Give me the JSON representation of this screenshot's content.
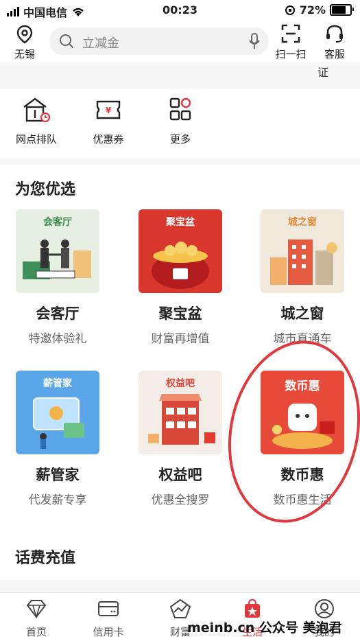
{
  "status": {
    "carrier": "中国电信",
    "time": "00:23",
    "battery": "72%"
  },
  "header": {
    "location": "无锡",
    "search_placeholder": "立减金",
    "scan": "扫一扫",
    "service": "客服"
  },
  "partial_row": {
    "last_label_fragment": "证"
  },
  "quick": [
    {
      "label": "网点排队",
      "icon": "bank-queue-icon"
    },
    {
      "label": "优惠券",
      "icon": "coupon-icon"
    },
    {
      "label": "更多",
      "icon": "grid-more-icon"
    }
  ],
  "recommend": {
    "title": "为您优选",
    "items": [
      {
        "name": "会客厅",
        "sub": "特邀体验礼",
        "tag": "会客厅",
        "bg": "#e7efe3"
      },
      {
        "name": "聚宝盆",
        "sub": "财富再增值",
        "tag": "聚宝盆",
        "bg": "#d9362e"
      },
      {
        "name": "城之窗",
        "sub": "城市直通车",
        "tag": "城之窗",
        "bg": "#f1e8dc"
      },
      {
        "name": "薪管家",
        "sub": "代发薪专享",
        "tag": "薪管家",
        "bg": "#5aa6e8"
      },
      {
        "name": "权益吧",
        "sub": "优惠全搜罗",
        "tag": "权益吧",
        "bg": "#f3ece7"
      },
      {
        "name": "数币惠",
        "sub": "数币惠生活",
        "tag": "数币惠",
        "bg": "#e84a3a"
      }
    ]
  },
  "phone_recharge": {
    "title": "话费充值"
  },
  "tabs": [
    {
      "label": "首页",
      "icon": "home-diamond-icon"
    },
    {
      "label": "信用卡",
      "icon": "credit-card-icon"
    },
    {
      "label": "财富",
      "icon": "wealth-chart-icon"
    },
    {
      "label": "生活",
      "icon": "life-bag-icon"
    },
    {
      "label": "我的",
      "icon": "profile-icon"
    }
  ],
  "watermark": "meinb.cn 公众号 美泡君",
  "colors": {
    "accent": "#e0383d"
  }
}
